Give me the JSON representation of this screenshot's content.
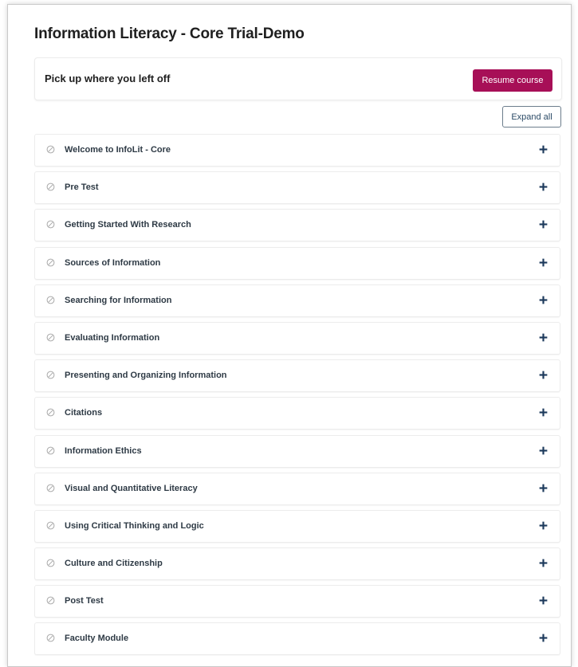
{
  "page": {
    "title": "Information Literacy - Core Trial-Demo"
  },
  "resume": {
    "text": "Pick up where you left off",
    "button_label": "Resume course"
  },
  "controls": {
    "expand_all_label": "Expand all"
  },
  "modules": [
    {
      "label": "Welcome to InfoLit - Core",
      "status_icon": "not-started-circle-icon",
      "toggle_icon": "plus-icon"
    },
    {
      "label": "Pre Test",
      "status_icon": "not-started-circle-icon",
      "toggle_icon": "plus-icon"
    },
    {
      "label": "Getting Started With Research",
      "status_icon": "not-started-circle-icon",
      "toggle_icon": "plus-icon"
    },
    {
      "label": "Sources of Information",
      "status_icon": "not-started-circle-icon",
      "toggle_icon": "plus-icon"
    },
    {
      "label": "Searching for Information",
      "status_icon": "not-started-circle-icon",
      "toggle_icon": "plus-icon"
    },
    {
      "label": "Evaluating Information",
      "status_icon": "not-started-circle-icon",
      "toggle_icon": "plus-icon"
    },
    {
      "label": "Presenting and Organizing Information",
      "status_icon": "not-started-circle-icon",
      "toggle_icon": "plus-icon"
    },
    {
      "label": "Citations",
      "status_icon": "not-started-circle-icon",
      "toggle_icon": "plus-icon"
    },
    {
      "label": "Information Ethics",
      "status_icon": "not-started-circle-icon",
      "toggle_icon": "plus-icon"
    },
    {
      "label": "Visual and Quantitative Literacy",
      "status_icon": "not-started-circle-icon",
      "toggle_icon": "plus-icon"
    },
    {
      "label": "Using Critical Thinking and Logic",
      "status_icon": "not-started-circle-icon",
      "toggle_icon": "plus-icon"
    },
    {
      "label": "Culture and Citizenship",
      "status_icon": "not-started-circle-icon",
      "toggle_icon": "plus-icon"
    },
    {
      "label": "Post Test",
      "status_icon": "not-started-circle-icon",
      "toggle_icon": "plus-icon"
    },
    {
      "label": "Faculty Module",
      "status_icon": "not-started-circle-icon",
      "toggle_icon": "plus-icon"
    }
  ],
  "colors": {
    "resume_button_bg": "#a70f57",
    "expand_button_text": "#2b4a66",
    "plus_icon": "#1d3a5c",
    "status_icon": "#a9a9a9"
  }
}
